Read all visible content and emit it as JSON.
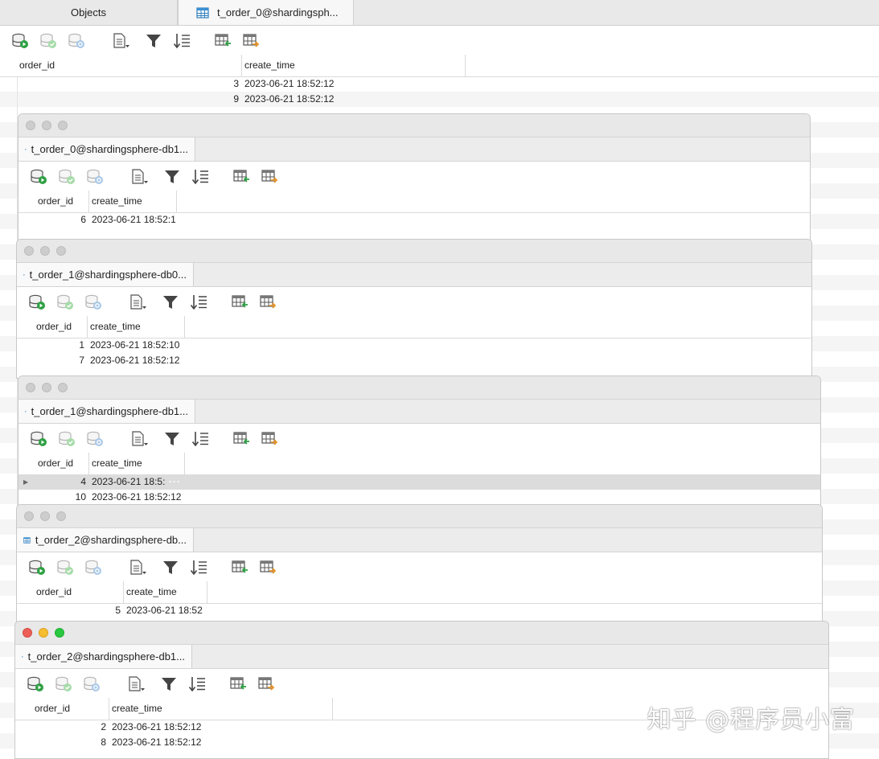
{
  "main": {
    "tabs": [
      {
        "label": "Objects"
      },
      {
        "label": "t_order_0@shardingsph..."
      }
    ],
    "columns": [
      "order_id",
      "create_time"
    ],
    "rows": [
      {
        "order_id": "3",
        "create_time": "2023-06-21 18:52:12"
      },
      {
        "order_id": "9",
        "create_time": "2023-06-21 18:52:12"
      }
    ]
  },
  "windows": [
    {
      "tab": "t_order_0@shardingsphere-db1...",
      "columns": [
        "order_id",
        "create_time"
      ],
      "rows": [
        {
          "order_id": "6",
          "create_time": "2023-06-21 18:52:1"
        }
      ]
    },
    {
      "tab": "t_order_1@shardingsphere-db0...",
      "columns": [
        "order_id",
        "create_time"
      ],
      "rows": [
        {
          "order_id": "1",
          "create_time": "2023-06-21 18:52:10"
        },
        {
          "order_id": "7",
          "create_time": "2023-06-21 18:52:12"
        }
      ]
    },
    {
      "tab": "t_order_1@shardingsphere-db1...",
      "columns": [
        "order_id",
        "create_time"
      ],
      "rows": [
        {
          "order_id": "4",
          "create_time": "2023-06-21 18:5:",
          "extra": "···",
          "selected": "true"
        },
        {
          "order_id": "10",
          "create_time": "2023-06-21 18:52:12"
        }
      ]
    },
    {
      "tab": "t_order_2@shardingsphere-db...",
      "columns": [
        "order_id",
        "create_time"
      ],
      "rows": [
        {
          "order_id": "5",
          "create_time": "2023-06-21 18:52"
        }
      ]
    },
    {
      "tab": "t_order_2@shardingsphere-db1...",
      "columns": [
        "order_id",
        "create_time"
      ],
      "rows": [
        {
          "order_id": "2",
          "create_time": "2023-06-21 18:52:12"
        },
        {
          "order_id": "8",
          "create_time": "2023-06-21 18:52:12"
        }
      ]
    }
  ],
  "toolbar_icons": [
    "db-run-icon",
    "db-commit-icon",
    "db-refresh-icon",
    "document-dropdown-icon",
    "filter-icon",
    "sort-icon",
    "import-table-icon",
    "export-table-icon"
  ],
  "colors": {
    "close": "#ed5e57",
    "minimize": "#f5bd2f",
    "zoom": "#28c840",
    "inactive": "#cdcdcd"
  },
  "watermark": "知乎 @程序员小富"
}
